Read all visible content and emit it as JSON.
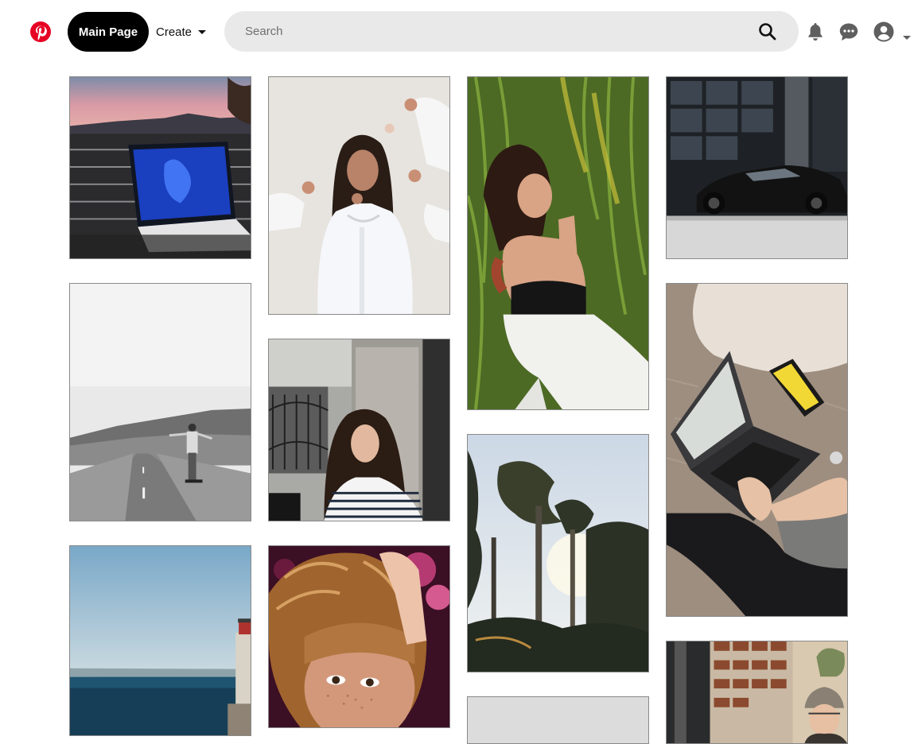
{
  "header": {
    "main_page_label": "Main Page",
    "create_label": "Create",
    "search_placeholder": "Search",
    "icons": {
      "logo": "pinterest-logo",
      "search": "search-icon",
      "notifications": "bell-icon",
      "messages": "chat-icon",
      "profile": "user-icon",
      "account_menu": "chevron-down-icon"
    }
  },
  "colors": {
    "brand": "#e60023",
    "search_bg": "#e9e9e9",
    "icon_gray": "#5f5f5f",
    "button_dark": "#000000"
  },
  "pins": [
    {
      "name": "laptop-on-balcony"
    },
    {
      "name": "woman-white-shirt-hands"
    },
    {
      "name": "woman-in-green-reeds"
    },
    {
      "name": "black-sports-car"
    },
    {
      "name": "longboarder-on-road"
    },
    {
      "name": "girl-by-stone-column"
    },
    {
      "name": "misty-forest-trees"
    },
    {
      "name": "laptop-on-fur-rug"
    },
    {
      "name": "lighthouse-by-sea"
    },
    {
      "name": "freckled-woman-hair"
    },
    {
      "name": "gray-pin-partial"
    },
    {
      "name": "woman-knit-hat-street"
    }
  ]
}
